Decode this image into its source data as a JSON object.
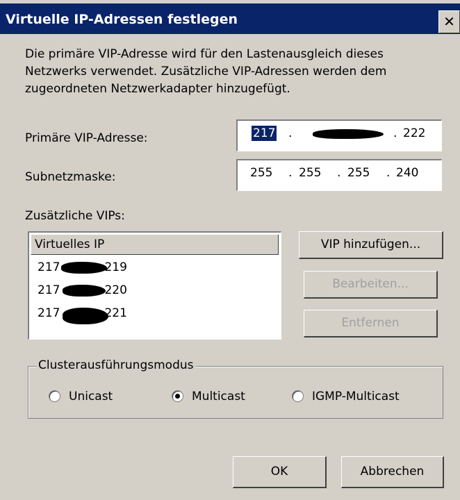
{
  "window": {
    "title": "Virtuelle IP-Adressen festlegen",
    "close_glyph": "✕"
  },
  "description": "Die primäre VIP-Adresse wird für den Lastenausgleich dieses Netzwerks verwendet. Zusätzliche VIP-Adressen werden dem zugeordneten Netzwerkadapter hinzugefügt.",
  "primary_vip": {
    "label": "Primäre VIP-Adresse:",
    "octet1": "217",
    "octet4": "222",
    "dot": "."
  },
  "subnet": {
    "label": "Subnetzmaske:",
    "octets": [
      "255",
      "255",
      "255",
      "240"
    ],
    "dot": "."
  },
  "additional": {
    "label": "Zusätzliche VIPs:",
    "column_header": "Virtuelles IP",
    "rows": [
      {
        "prefix": "217",
        "suffix": "219"
      },
      {
        "prefix": "217",
        "suffix": "220"
      },
      {
        "prefix": "217",
        "suffix": "221"
      }
    ]
  },
  "buttons": {
    "add": "VIP hinzufügen...",
    "edit": "Bearbeiten...",
    "remove": "Entfernen",
    "ok": "OK",
    "cancel": "Abbrechen"
  },
  "cluster_mode": {
    "label": "Clusterausführungsmodus",
    "options": [
      "Unicast",
      "Multicast",
      "IGMP-Multicast"
    ],
    "selected": "Multicast"
  },
  "colors": {
    "titlebar": "#0a246a",
    "dialog_bg": "#d4d0c8",
    "disabled_text": "#a0a0a0"
  }
}
